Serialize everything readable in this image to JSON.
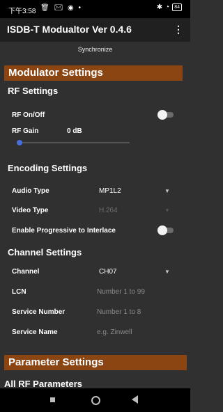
{
  "status_bar": {
    "time": "下午3:58",
    "left_icons": "🗑 ✉ ◉ •",
    "battery": "84"
  },
  "app_bar": {
    "title": "ISDB-T Modualtor Ver 0.4.6",
    "menu_icon": "⋮"
  },
  "sync_label": "Synchronize",
  "modulator_settings": {
    "header": "Modulator Settings",
    "rf": {
      "title": "RF Settings",
      "onoff_label": "RF On/Off",
      "onoff_state": false,
      "gain_label": "RF Gain",
      "gain_value": "0 dB"
    },
    "encoding": {
      "title": "Encoding Settings",
      "audio_label": "Audio Type",
      "audio_value": "MP1L2",
      "video_label": "Video Type",
      "video_value": "H.264",
      "progressive_label": "Enable Progressive to Interlace",
      "progressive_state": false
    },
    "channel": {
      "title": "Channel Settings",
      "channel_label": "Channel",
      "channel_value": "CH07",
      "lcn_label": "LCN",
      "lcn_placeholder": "Number 1 to 99",
      "service_number_label": "Service Number",
      "service_number_placeholder": "Number 1 to 8",
      "service_name_label": "Service Name",
      "service_name_placeholder": "e.g. Zinwell"
    }
  },
  "parameter_settings": {
    "header": "Parameter Settings",
    "all_rf_title": "All RF Parameters"
  },
  "colors": {
    "background": "#303030",
    "header_bar": "#8b4513",
    "slider_accent": "#4a6fdc"
  }
}
